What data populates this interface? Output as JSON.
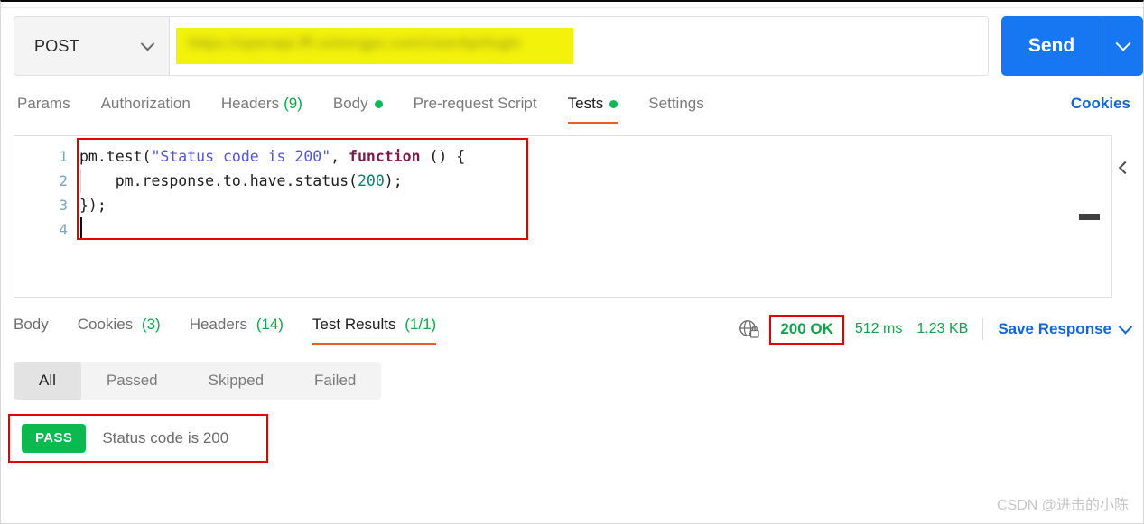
{
  "request": {
    "method": "POST",
    "method_caret_icon": "chevron-down-icon",
    "url_value": "https://openapi.fff.xxlxnrgpx.com/UserApi/login",
    "url_redacted": true,
    "url_highlight_color": "#f3f20a",
    "send_label": "Send",
    "send_caret_icon": "chevron-down-icon",
    "send_color": "#1777f2"
  },
  "request_tabs": {
    "items": [
      {
        "label": "Params",
        "count": "",
        "dot": false,
        "active": false
      },
      {
        "label": "Authorization",
        "count": "",
        "dot": false,
        "active": false
      },
      {
        "label": "Headers",
        "count": "(9)",
        "dot": false,
        "active": false
      },
      {
        "label": "Body",
        "count": "",
        "dot": true,
        "active": false
      },
      {
        "label": "Pre-request Script",
        "count": "",
        "dot": false,
        "active": false
      },
      {
        "label": "Tests",
        "count": "",
        "dot": true,
        "active": true
      },
      {
        "label": "Settings",
        "count": "",
        "dot": false,
        "active": false
      }
    ],
    "cookies_link": "Cookies",
    "active_underline_color": "#ef5b25"
  },
  "editor": {
    "line_numbers": [
      "1",
      "2",
      "3",
      "4"
    ],
    "lines": [
      {
        "n": "1",
        "segments": [
          {
            "t": "pm.test(",
            "c": "plain"
          },
          {
            "t": "\"Status code is 200\"",
            "c": "string"
          },
          {
            "t": ", ",
            "c": "plain"
          },
          {
            "t": "function",
            "c": "keyword"
          },
          {
            "t": " () {",
            "c": "plain"
          }
        ]
      },
      {
        "n": "2",
        "segments": [
          {
            "t": "    pm.response.to.have.status(",
            "c": "plain"
          },
          {
            "t": "200",
            "c": "number"
          },
          {
            "t": ");",
            "c": "plain"
          }
        ]
      },
      {
        "n": "3",
        "segments": [
          {
            "t": "});",
            "c": "plain"
          }
        ]
      },
      {
        "n": "4",
        "segments": [
          {
            "t": "",
            "c": "plain"
          }
        ]
      }
    ],
    "plain_text": "pm.test(\"Status code is 200\", function () {\n    pm.response.to.have.status(200);\n});\n",
    "collapse_icon": "chevron-left-icon",
    "annotation_color": "#e60000"
  },
  "response_tabs": {
    "items": [
      {
        "label": "Body",
        "count": "",
        "active": false
      },
      {
        "label": "Cookies",
        "count": "(3)",
        "active": false
      },
      {
        "label": "Headers",
        "count": "(14)",
        "active": false
      },
      {
        "label": "Test Results",
        "count": "(1/1)",
        "active": true
      }
    ]
  },
  "response_meta": {
    "security_icon": "globe-lock-icon",
    "status": "200 OK",
    "time": "512 ms",
    "size": "1.23 KB",
    "save_label": "Save Response",
    "save_caret_icon": "chevron-down-icon",
    "status_color": "#11a24a",
    "annotation_color": "#e60000"
  },
  "result_filters": {
    "items": [
      {
        "label": "All",
        "active": true
      },
      {
        "label": "Passed",
        "active": false
      },
      {
        "label": "Skipped",
        "active": false
      },
      {
        "label": "Failed",
        "active": false
      }
    ]
  },
  "test_results": {
    "rows": [
      {
        "badge": "PASS",
        "name": "Status code is 200",
        "badge_color": "#0cb94f"
      }
    ]
  },
  "watermark": {
    "text": "CSDN @进击的小陈"
  }
}
